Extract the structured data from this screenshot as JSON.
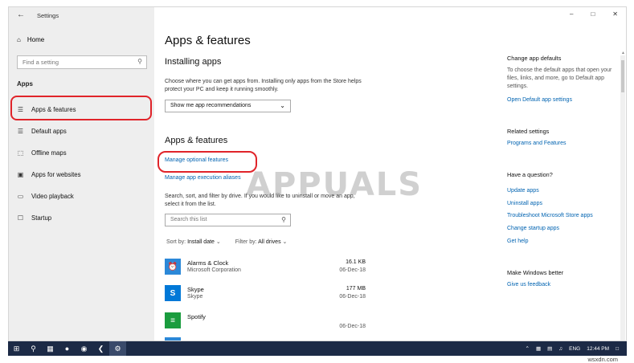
{
  "window": {
    "title": "Settings",
    "controls": [
      "–",
      "□",
      "✕"
    ]
  },
  "sidebar": {
    "home_label": "Home",
    "search_placeholder": "Find a setting",
    "section_label": "Apps",
    "items": [
      {
        "label": "Apps & features",
        "icon": "apps-features-icon",
        "glyph": "☰"
      },
      {
        "label": "Default apps",
        "icon": "default-apps-icon",
        "glyph": "☰"
      },
      {
        "label": "Offline maps",
        "icon": "map-icon",
        "glyph": "⬚"
      },
      {
        "label": "Apps for websites",
        "icon": "website-icon",
        "glyph": "▣"
      },
      {
        "label": "Video playback",
        "icon": "video-icon",
        "glyph": "▭"
      },
      {
        "label": "Startup",
        "icon": "startup-icon",
        "glyph": "☐"
      }
    ]
  },
  "main": {
    "page_title": "Apps & features",
    "installing": {
      "heading": "Installing apps",
      "description": "Choose where you can get apps from. Installing only apps from the Store helps protect your PC and keep it running smoothly.",
      "dropdown_value": "Show me app recommendations"
    },
    "apps": {
      "heading": "Apps & features",
      "link_optional": "Manage optional features",
      "link_aliases": "Manage app execution aliases",
      "description": "Search, sort, and filter by drive. If you would like to uninstall or move an app, select it from the list.",
      "search_placeholder": "Search this list",
      "sort_label": "Sort by:",
      "sort_value": "Install date",
      "filter_label": "Filter by:",
      "filter_value": "All drives",
      "list": [
        {
          "name": "Alarms & Clock",
          "publisher": "Microsoft Corporation",
          "size": "16.1 KB",
          "date": "06-Dec-18",
          "color": "#2b88d8",
          "glyph": "⏰"
        },
        {
          "name": "Skype",
          "publisher": "Skype",
          "size": "177 MB",
          "date": "06-Dec-18",
          "color": "#0078d7",
          "glyph": "S"
        },
        {
          "name": "Spotify",
          "publisher": "",
          "size": "",
          "date": "06-Dec-18",
          "color": "#1a9c3e",
          "glyph": "≡"
        }
      ]
    }
  },
  "right": {
    "default_heading": "Change app defaults",
    "default_text": "To choose the default apps that open your files, links, and more, go to Default app settings.",
    "default_link": "Open Default app settings",
    "related_heading": "Related settings",
    "related_link": "Programs and Features",
    "question_heading": "Have a question?",
    "question_links": [
      "Update apps",
      "Uninstall apps",
      "Troubleshoot Microsoft Store apps",
      "Change startup apps",
      "Get help"
    ],
    "feedback_heading": "Make Windows better",
    "feedback_link": "Give us feedback"
  },
  "watermark": "APPUALS",
  "taskbar": {
    "language": "ENG",
    "time": "12:44 PM"
  },
  "site_watermark": "wsxdn.com",
  "colors": {
    "accent": "#0063b1",
    "highlight_ring": "#e0242a",
    "taskbar": "#1c2a46",
    "sidebar": "#eeeeee"
  }
}
